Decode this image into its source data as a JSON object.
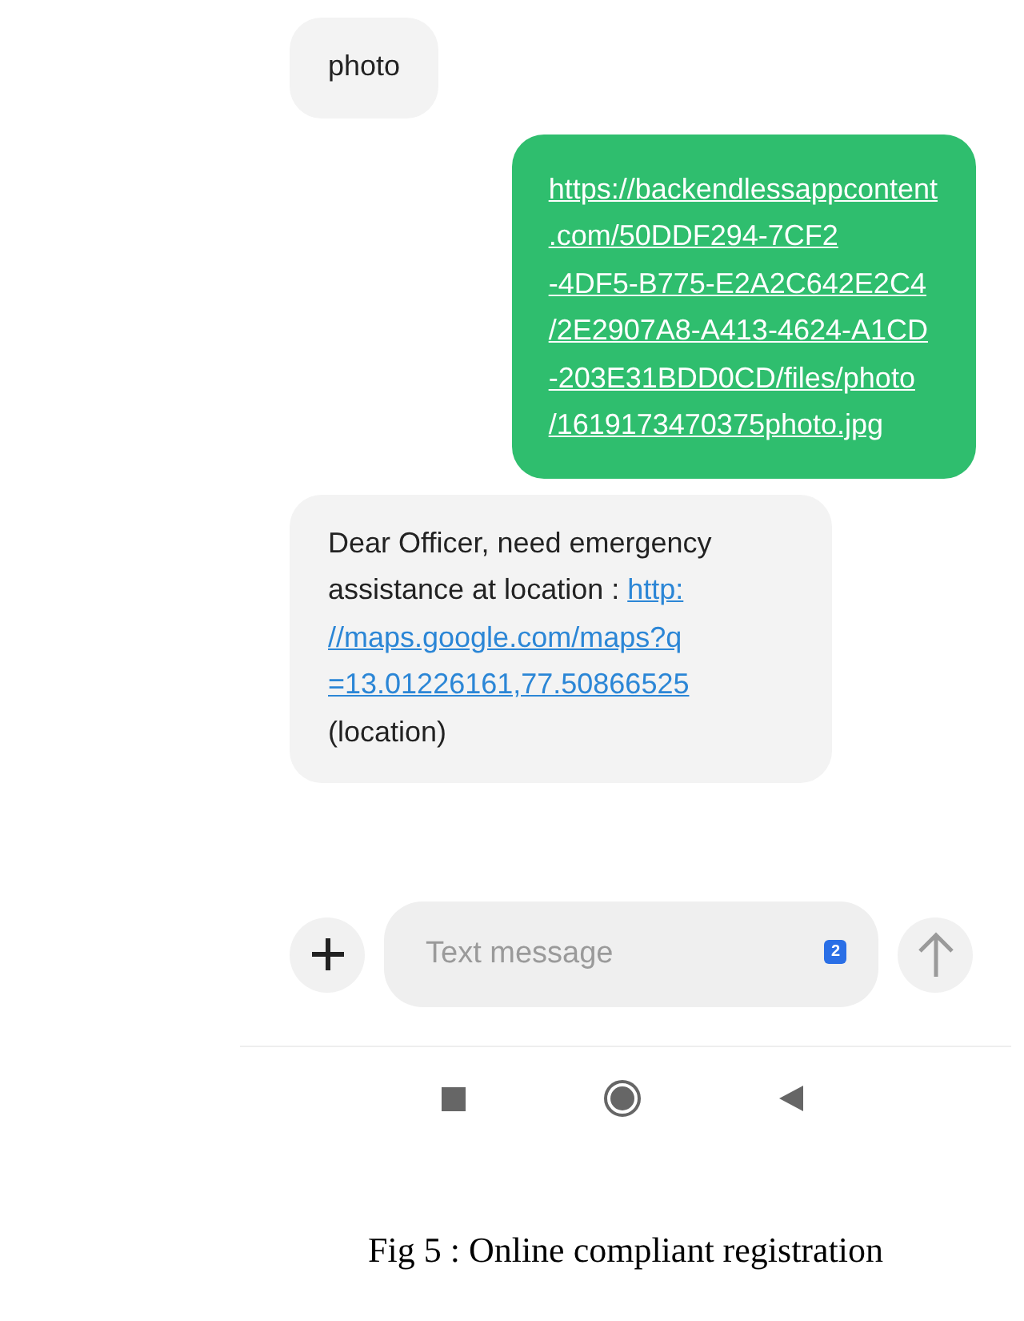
{
  "messages": [
    {
      "outgoing": false,
      "kind": "text",
      "text": "photo"
    },
    {
      "outgoing": true,
      "kind": "link",
      "link_lines": [
        "https://backendlessappcontent",
        ".com/50DDF294-7CF2",
        "-4DF5-B775-E2A2C642E2C4",
        "/2E2907A8-A413-4624-A1CD",
        "-203E31BDD0CD/files/photo",
        "/1619173470375photo.jpg"
      ]
    },
    {
      "outgoing": false,
      "kind": "mixed",
      "lines_before": [
        "Dear Officer, need emergency",
        "assistance at location : "
      ],
      "link_lines": [
        "http:",
        "//maps.google.com/maps?q",
        "=13.01226161,77.50866525"
      ],
      "text_after": "(location)"
    }
  ],
  "composer": {
    "placeholder": "Text message",
    "sim_badge": "2",
    "send_enabled": false
  },
  "caption": "Fig 5 : Online compliant registration"
}
